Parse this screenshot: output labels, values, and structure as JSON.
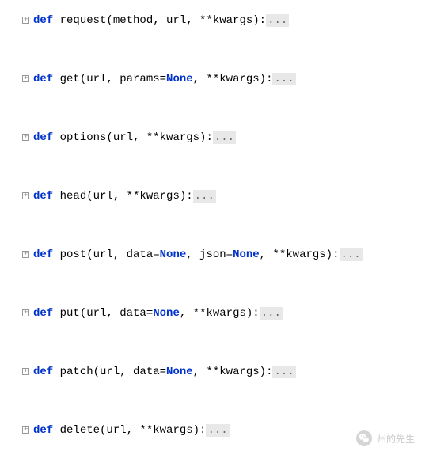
{
  "keywords": {
    "def": "def",
    "none": "None"
  },
  "ellipsis": "...",
  "functions": [
    {
      "name": "request",
      "sig_pre": " request(method, url, **kwargs):",
      "params_with_none": []
    },
    {
      "name": "get",
      "sig_parts": [
        " get(url, params=",
        ", **kwargs):"
      ],
      "has_none": true
    },
    {
      "name": "options",
      "sig_pre": " options(url, **kwargs):",
      "params_with_none": []
    },
    {
      "name": "head",
      "sig_pre": " head(url, **kwargs):",
      "params_with_none": []
    },
    {
      "name": "post",
      "sig_parts": [
        " post(url, data=",
        ", json=",
        ", **kwargs):"
      ],
      "has_none": true,
      "none_count": 2
    },
    {
      "name": "put",
      "sig_parts": [
        " put(url, data=",
        ", **kwargs):"
      ],
      "has_none": true
    },
    {
      "name": "patch",
      "sig_parts": [
        " patch(url, data=",
        ", **kwargs):"
      ],
      "has_none": true
    },
    {
      "name": "delete",
      "sig_pre": " delete(url, **kwargs):",
      "params_with_none": []
    }
  ],
  "watermark": {
    "text": "州的先生"
  }
}
